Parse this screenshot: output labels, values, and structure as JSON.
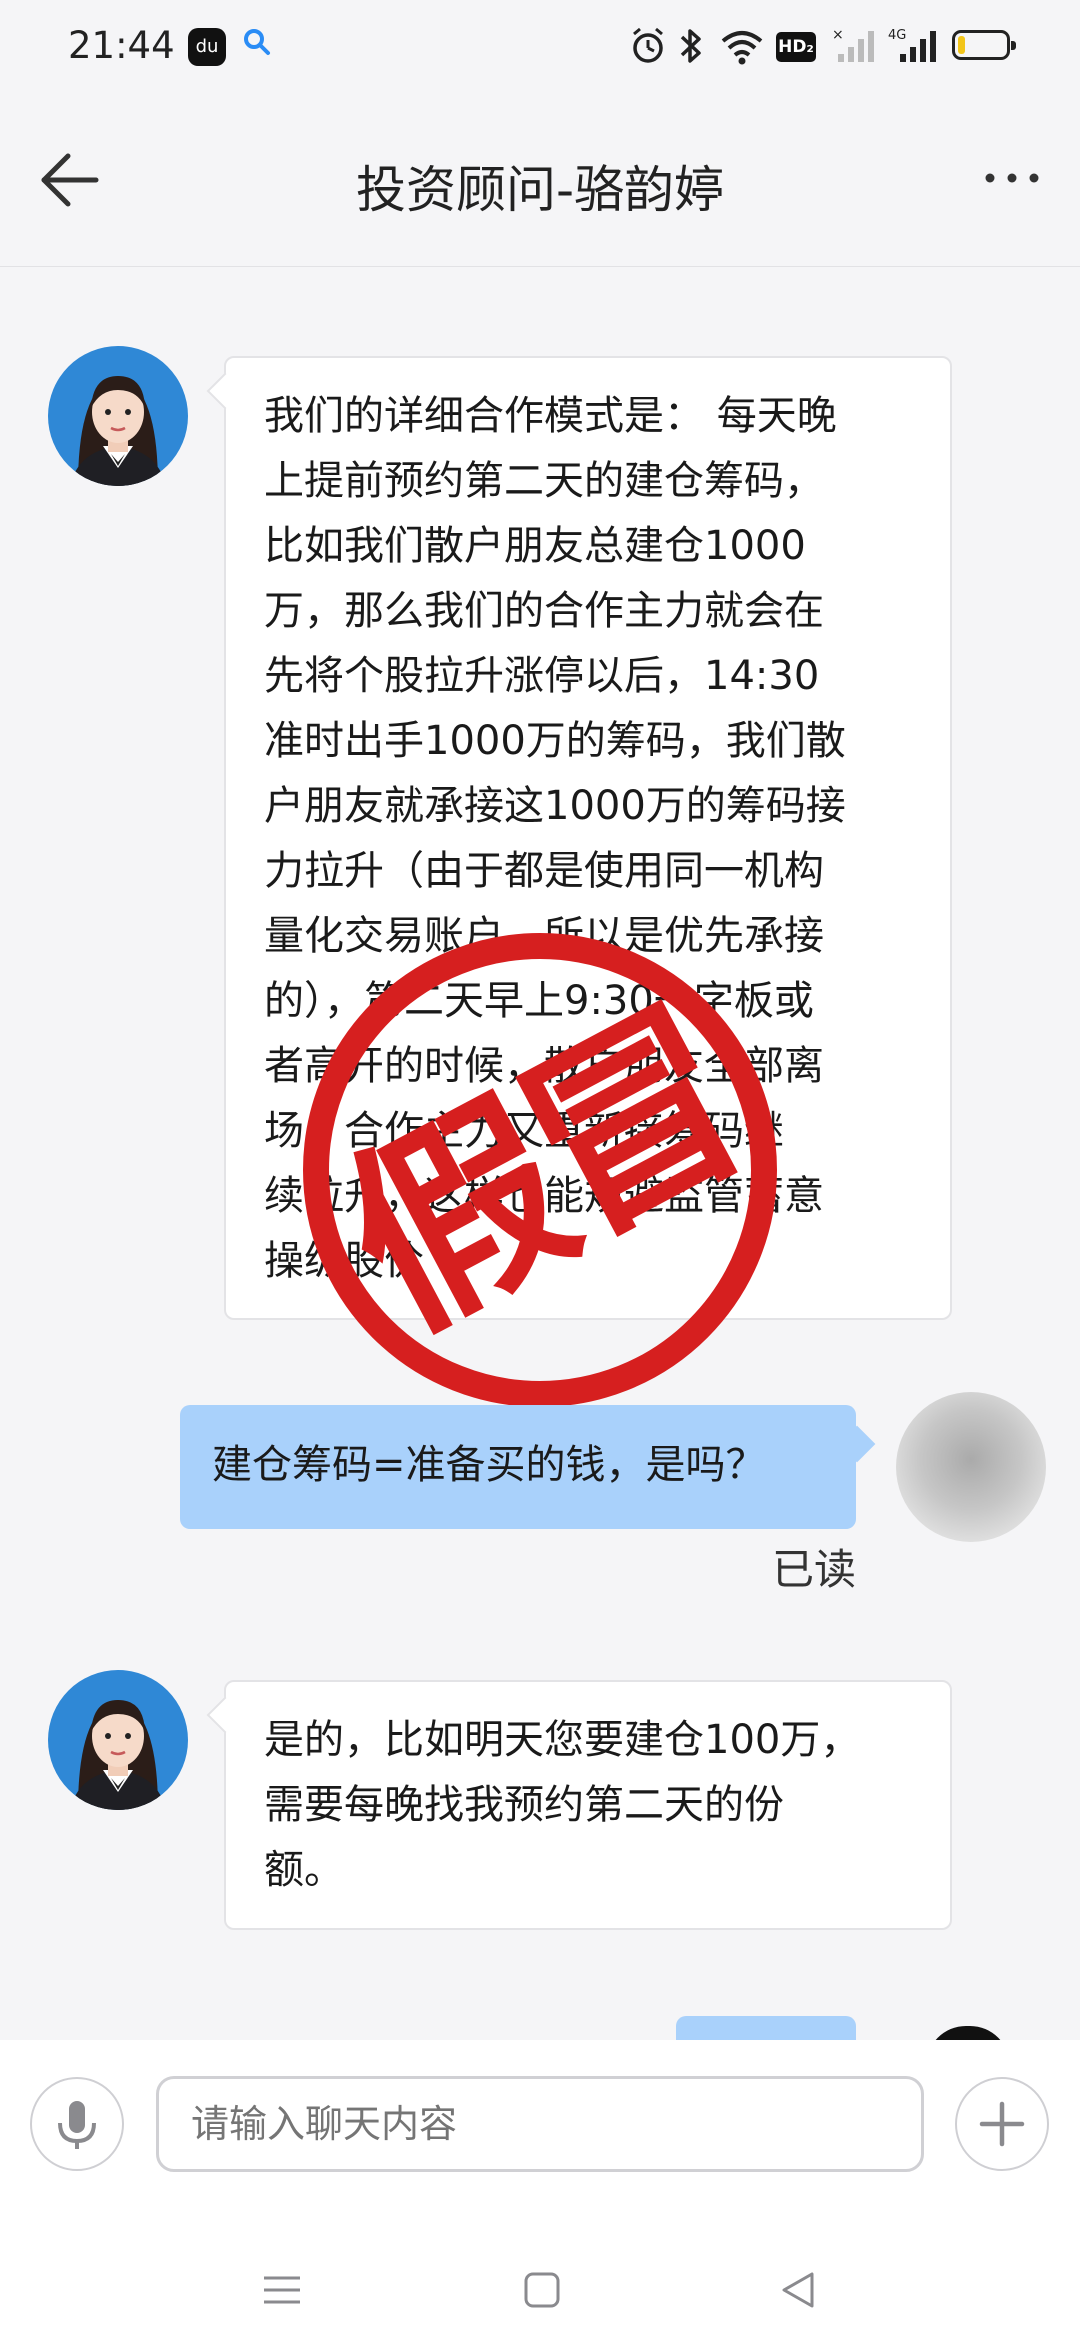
{
  "status_bar": {
    "time": "21:44",
    "app_badge": "du",
    "hd_label": "HD₂",
    "network_label": "4G",
    "icons": [
      "du-app-icon",
      "search-icon",
      "alarm-icon",
      "bluetooth-icon",
      "wifi-icon",
      "hd-icon",
      "signal-icon",
      "signal-4g-icon",
      "battery-icon"
    ],
    "battery_level": 0.15,
    "battery_color": "#f2c51a"
  },
  "header": {
    "title": "投资顾问-骆韵婷",
    "back_icon": "arrow-left-icon",
    "more_icon": "more-dots-icon"
  },
  "messages": [
    {
      "side": "incoming",
      "lines": [
        "我们的详细合作模式是： 每天晚",
        "上提前预约第二天的建仓筹码，",
        "比如我们散户朋友总建仓1000",
        "万，那么我们的合作主力就会在",
        "先将个股拉升涨停以后，14:30",
        "准时出手1000万的筹码，我们散",
        "户朋友就承接这1000万的筹码接",
        "力拉升（由于都是使用同一机构",
        "量化交易账户，所以是优先承接",
        "的），第二天早上9:30一字板或",
        "者高开的时候，散户朋友全部离",
        "场，合作主力又重新接筹码继",
        "续拉升，这样也能规避监管蓄意",
        "操纵股价"
      ]
    },
    {
      "side": "outgoing",
      "text": "建仓筹码=准备买的钱，是吗？",
      "status": "已读"
    },
    {
      "side": "incoming",
      "lines": [
        "是的，比如明天您要建仓100万，",
        "需要每晚找我预约第二天的份",
        "额。"
      ]
    }
  ],
  "stamp": {
    "text": "假冒",
    "color": "#d61f1f"
  },
  "composer": {
    "placeholder": "请输入聊天内容",
    "mic_icon": "microphone-icon",
    "plus_icon": "plus-icon"
  },
  "nav_bar": {
    "icons": [
      "menu-icon",
      "home-square-icon",
      "back-triangle-icon"
    ]
  },
  "colors": {
    "outgoing_bubble": "#a9d1fb",
    "background": "#f5f5f7",
    "accent_blue": "#2a8cf5"
  }
}
